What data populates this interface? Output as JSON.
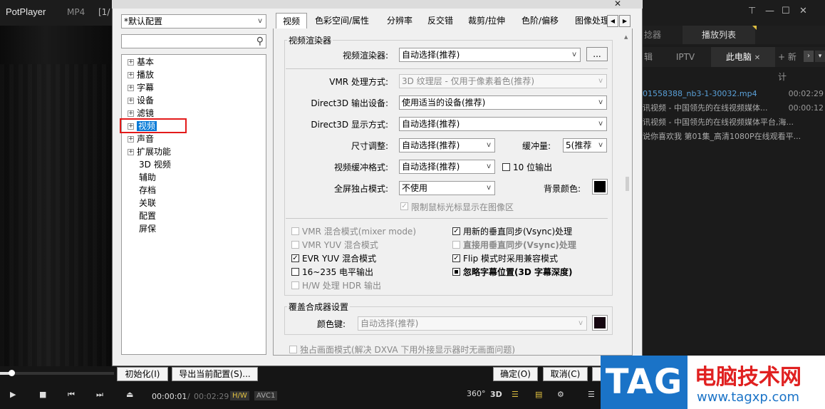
{
  "player": {
    "logo": "PotPlayer",
    "format": "MP4",
    "index": "[1/",
    "time_current": "00:00:01",
    "time_sep": "/",
    "time_total": "00:02:29",
    "badge_hw": "H/W",
    "badge_codec": "AVC1",
    "badge_360": "360°",
    "badge_3d": "3D"
  },
  "playlist": {
    "tab_prev": "捻器",
    "tab_active": "播放列表",
    "sub_tabs": [
      "辑",
      "IPTV",
      "此电脑",
      "+ 新计"
    ],
    "rows": [
      {
        "name": "01558388_nb3-1-30032.mp4",
        "time": "00:02:29"
      },
      {
        "name": "讯视频 - 中国领先的在线视频媒体...",
        "time": "00:00:12"
      },
      {
        "name": "讯视频 - 中国领先的在线视频媒体平台,海...",
        "time": ""
      },
      {
        "name": "说你喜欢我 第01集_高清1080P在线观看平...",
        "time": ""
      }
    ]
  },
  "dialog": {
    "profile": "*默认配置",
    "tree": [
      "基本",
      "播放",
      "字幕",
      "设备",
      "滤镜",
      "视频",
      "声音",
      "扩展功能",
      "3D 视频",
      "辅助",
      "存档",
      "关联",
      "配置",
      "屏保"
    ],
    "tree_expandable": [
      true,
      true,
      true,
      true,
      true,
      true,
      true,
      true,
      false,
      false,
      false,
      false,
      false,
      false
    ],
    "selected_index": 5,
    "tabs": [
      "视频",
      "色彩空间/属性",
      "分辨率",
      "反交错",
      "裁剪/拉伸",
      "色阶/偏移",
      "图像处理"
    ],
    "group_renderer": "视频渲染器",
    "renderer_label": "视频渲染器:",
    "renderer_value": "自动选择(推荐)",
    "renderer_btn": "...",
    "vmr_label": "VMR 处理方式:",
    "vmr_value": "3D 纹理层 - 仅用于像素着色(推荐)",
    "d3d_out_label": "Direct3D 输出设备:",
    "d3d_out_value": "使用适当的设备(推荐)",
    "d3d_disp_label": "Direct3D 显示方式:",
    "d3d_disp_value": "自动选择(推荐)",
    "resize_label": "尺寸调整:",
    "resize_value": "自动选择(推荐)",
    "buffer_label": "缓冲量:",
    "buffer_value": "5(推荐",
    "bufformat_label": "视频缓冲格式:",
    "bufformat_value": "自动选择(推荐)",
    "tenbit_label": "10 位输出",
    "fullscreen_label": "全屏独占模式:",
    "fullscreen_value": "不使用",
    "bgcolor_label": "背景颜色:",
    "limit_mouse_label": "限制鼠标光标显示在图像区",
    "options": [
      {
        "label": "VMR 混合模式(mixer mode)",
        "checked": false,
        "disabled": true
      },
      {
        "label": "用新的垂直同步(Vsync)处理",
        "checked": true,
        "disabled": false
      },
      {
        "label": "VMR YUV 混合模式",
        "checked": false,
        "disabled": true
      },
      {
        "label": "直接用垂直同步(Vsync)处理",
        "checked": false,
        "disabled": true
      },
      {
        "label": "EVR YUV 混合模式",
        "checked": true,
        "disabled": false
      },
      {
        "label": "Flip 模式时采用兼容模式",
        "checked": true,
        "disabled": false
      },
      {
        "label": "16~235 电平输出",
        "checked": false,
        "disabled": false
      },
      {
        "label": "忽略字幕位置(3D 字幕深度)",
        "checked": "partial",
        "disabled": false
      },
      {
        "label": "H/W 处理 HDR 输出",
        "checked": false,
        "disabled": true
      }
    ],
    "group_overlay": "覆盖合成器设置",
    "colorkey_label": "颜色键:",
    "colorkey_value": "自动选择(推荐)",
    "exclusive_label": "独占画面模式(解决 DXVA 下用外接显示器时无画面问题)",
    "btn_init": "初始化(I)",
    "btn_export": "导出当前配置(S)...",
    "btn_ok": "确定(O)",
    "btn_cancel": "取消(C)"
  },
  "watermark": {
    "tag": "TAG",
    "cn": "电脑技术网",
    "url": "www.tagxp.com"
  },
  "colors": {
    "selection": "#0078d7",
    "highlight_box": "#e31b1b",
    "watermark_blue": "#1a73c7",
    "watermark_red": "#e02020"
  }
}
